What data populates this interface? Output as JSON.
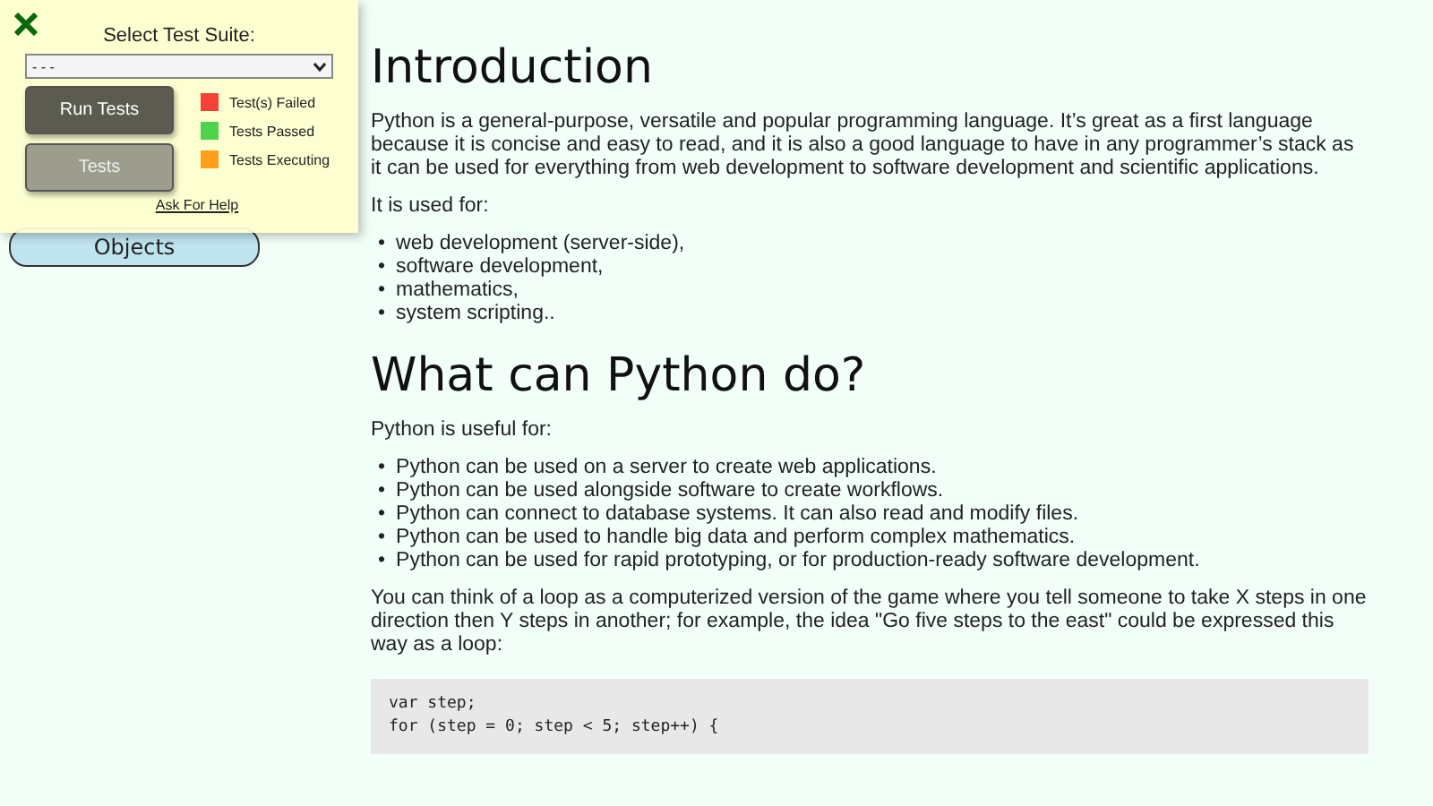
{
  "sidebar": {
    "items": [
      {
        "label": "Objects",
        "selected": false
      }
    ]
  },
  "test_panel": {
    "title": "Select Test Suite:",
    "suite_select": {
      "value": "- - -"
    },
    "buttons": [
      {
        "label": "Run Tests",
        "disabled": false
      },
      {
        "label": "Tests",
        "disabled": true
      }
    ],
    "legend": [
      {
        "label": "Test(s) Failed",
        "color": "#f44336"
      },
      {
        "label": "Tests Passed",
        "color": "#4cd44c"
      },
      {
        "label": "Tests Executing",
        "color": "#ff9f1a"
      }
    ],
    "help_link": "Ask For Help"
  },
  "sections": [
    {
      "heading": "Introduction",
      "blocks": [
        {
          "kind": "paragraph",
          "text": "Python is a general-purpose, versatile and popular programming language. It’s great as a first language because it is concise and easy to read, and it is also a good language to have in any programmer’s stack as it can be used for everything from web development to software development and scientific applications."
        },
        {
          "kind": "paragraph",
          "text": "It is used for:"
        },
        {
          "kind": "list",
          "marker": "•",
          "items": [
            "web development (server-side),",
            "software development,",
            "mathematics,",
            "system scripting.."
          ]
        }
      ]
    },
    {
      "heading": "What can Python do?",
      "blocks": [
        {
          "kind": "paragraph",
          "text": "Python is useful for:"
        },
        {
          "kind": "list",
          "marker": "•",
          "items": [
            "Python can be used on a server to create web applications.",
            "Python can be used alongside software to create workflows.",
            "Python can connect to database systems. It can also read and modify files.",
            "Python can be used to handle big data and perform complex mathematics.",
            "Python can be used for rapid prototyping, or for production-ready software development."
          ]
        },
        {
          "kind": "paragraph",
          "text": "You can think of a loop as a computerized version of the game where you tell someone to take X steps in one direction then Y steps in another; for example, the idea \"Go five steps to the east\" could be expressed this way as a loop:"
        },
        {
          "kind": "code",
          "lines": [
            "var step;",
            "for (step = 0; step < 5; step++) {"
          ]
        }
      ]
    }
  ]
}
